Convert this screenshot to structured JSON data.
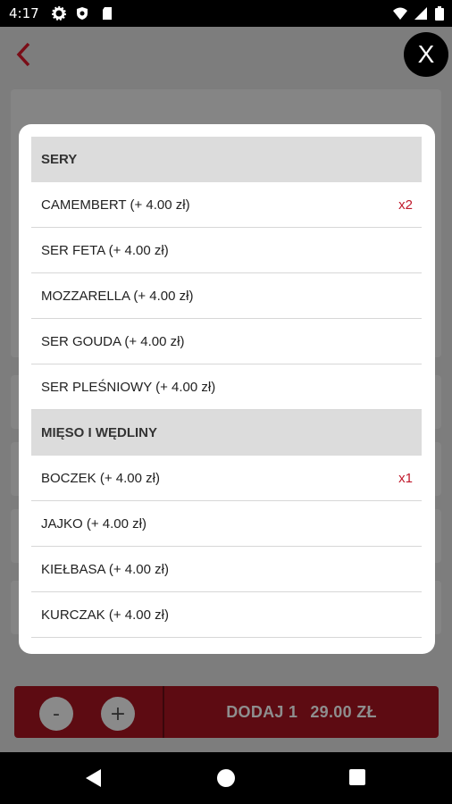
{
  "status_bar": {
    "time": "4:17",
    "left_icons": [
      "gear-icon",
      "shield-icon",
      "sd-card-icon"
    ],
    "right_icons": [
      "wifi-icon",
      "signal-icon",
      "battery-icon"
    ]
  },
  "header": {
    "back_icon": "chevron-left-icon",
    "close_label": "X",
    "accent_color": "#8b0f1b"
  },
  "modal": {
    "sections": [
      {
        "title": "SERY",
        "items": [
          {
            "label": "CAMEMBERT (+ 4.00 zł)",
            "qty": "x2"
          },
          {
            "label": "SER FETA (+ 4.00 zł)",
            "qty": ""
          },
          {
            "label": "MOZZARELLA (+ 4.00 zł)",
            "qty": ""
          },
          {
            "label": "SER GOUDA (+ 4.00 zł)",
            "qty": ""
          },
          {
            "label": "SER PLEŚNIOWY (+ 4.00 zł)",
            "qty": ""
          }
        ]
      },
      {
        "title": "MIĘSO I WĘDLINY",
        "items": [
          {
            "label": "BOCZEK (+ 4.00 zł)",
            "qty": "x1"
          },
          {
            "label": "JAJKO (+ 4.00 zł)",
            "qty": ""
          },
          {
            "label": "KIEŁBASA (+ 4.00 zł)",
            "qty": ""
          },
          {
            "label": "KURCZAK (+ 4.00 zł)",
            "qty": ""
          }
        ]
      }
    ]
  },
  "action_bar": {
    "minus_label": "-",
    "plus_label": "+",
    "add_label": "DODAJ 1",
    "price": "29.00 ZŁ"
  },
  "nav_bar": {
    "icons": [
      "back-triangle-icon",
      "home-circle-icon",
      "recents-square-icon"
    ]
  }
}
